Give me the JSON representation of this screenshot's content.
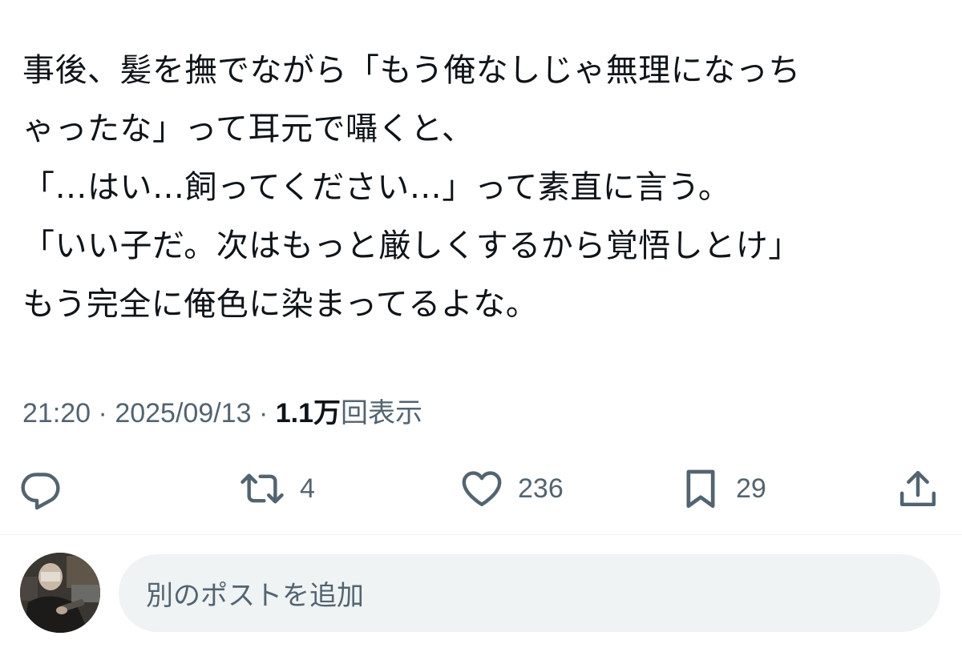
{
  "post": {
    "lines": [
      "事後、髪を撫でながら「もう俺なしじゃ無理になっち",
      "ゃったな」って耳元で囁くと、",
      "「…はい…飼ってください…」って素直に言う。",
      "「いい子だ。次はもっと厳しくするから覚悟しとけ」",
      "もう完全に俺色に染まってるよな。"
    ]
  },
  "meta": {
    "time": "21:20",
    "separator": "·",
    "date": "2025/09/13",
    "views_count": "1.1万",
    "views_label": "回表示"
  },
  "actions": {
    "reply": {
      "icon": "reply-icon"
    },
    "repost": {
      "icon": "repost-icon",
      "count": "4"
    },
    "like": {
      "icon": "heart-icon",
      "count": "236"
    },
    "bookmark": {
      "icon": "bookmark-icon",
      "count": "29"
    },
    "share": {
      "icon": "share-icon"
    }
  },
  "reply_composer": {
    "placeholder": "別のポストを追加"
  },
  "colors": {
    "text": "#0f1419",
    "secondary": "#536471",
    "input_bg": "#eff3f4",
    "divider": "#eff3f4"
  }
}
